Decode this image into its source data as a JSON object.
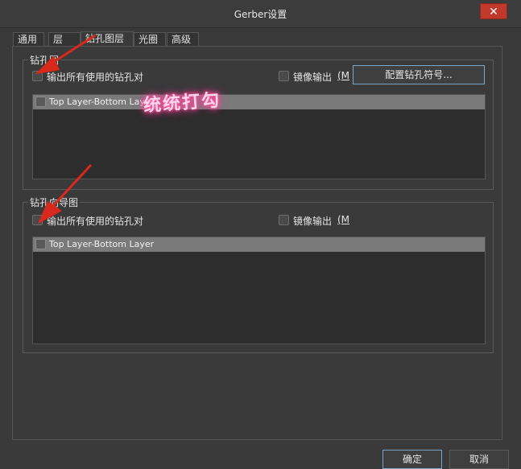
{
  "window": {
    "title": "Gerber设置",
    "close_symbol": "✕"
  },
  "tabs": [
    {
      "label": "通用",
      "active": false
    },
    {
      "label": "层",
      "active": false
    },
    {
      "label": "钻孔图层",
      "active": true
    },
    {
      "label": "光圈",
      "active": false
    },
    {
      "label": "高级",
      "active": false
    }
  ],
  "drill_drawing": {
    "title": "钻孔图",
    "output_all_label": "输出所有使用的钻孔对",
    "mirror_label": "镜像输出",
    "mirror_hotkey": "(M",
    "config_button": "配置钻孔符号...",
    "layer_pairs": [
      "Top Layer-Bottom Layer"
    ]
  },
  "drill_guide": {
    "title": "钻孔向导图",
    "output_all_label": "输出所有使用的钻孔对",
    "mirror_label": "镜像输出",
    "mirror_hotkey": "(M",
    "layer_pairs": [
      "Top Layer-Bottom Layer"
    ]
  },
  "annotation": {
    "text": "统统打勾",
    "color": "#ff4fa0"
  },
  "footer": {
    "ok_label": "确定",
    "cancel_label": "取消"
  },
  "colors": {
    "accent_border": "#7aa6c7",
    "close_red": "#c0392b",
    "arrow_red": "#d9281c"
  }
}
